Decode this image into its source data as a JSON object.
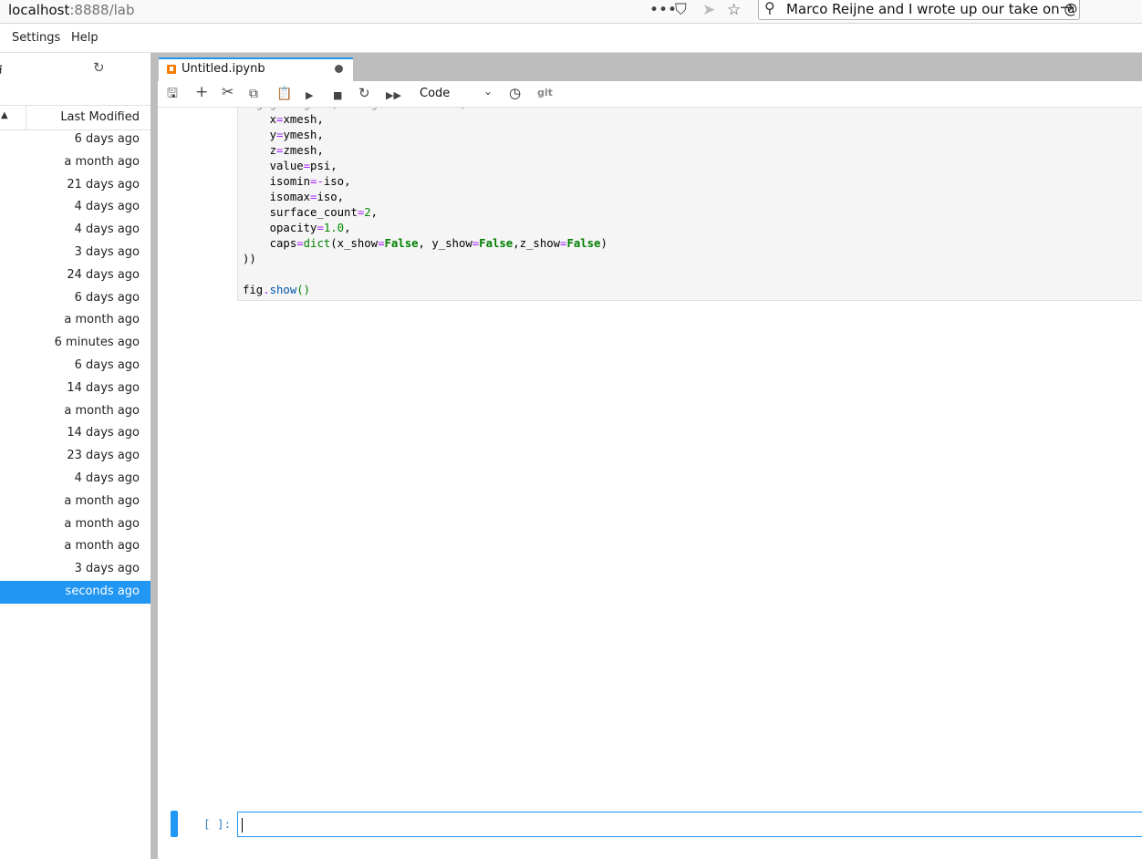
{
  "browser": {
    "url_host": "localhost",
    "url_rest": ":8888/lab",
    "search_text": "Marco Reijne and I wrote up our take on @"
  },
  "menu": {
    "settings": "Settings",
    "help": "Help"
  },
  "filebrowser": {
    "column_label": "Last Modified",
    "rows": [
      "6 days ago",
      "a month ago",
      "21 days ago",
      "4 days ago",
      "4 days ago",
      "3 days ago",
      "24 days ago",
      "6 days ago",
      "a month ago",
      "6 minutes ago",
      "6 days ago",
      "14 days ago",
      "a month ago",
      "14 days ago",
      "23 days ago",
      "4 days ago",
      "a month ago",
      "a month ago",
      "a month ago",
      "3 days ago",
      "seconds ago"
    ],
    "selected_index": 20
  },
  "tab": {
    "label": "Untitled.ipynb"
  },
  "toolbar": {
    "cell_type": "Code",
    "git": "git"
  },
  "cell": {
    "empty_prompt": "[ ]:"
  },
  "colors": {
    "accent": "#2196f3",
    "tab_icon": "#f57c00"
  }
}
